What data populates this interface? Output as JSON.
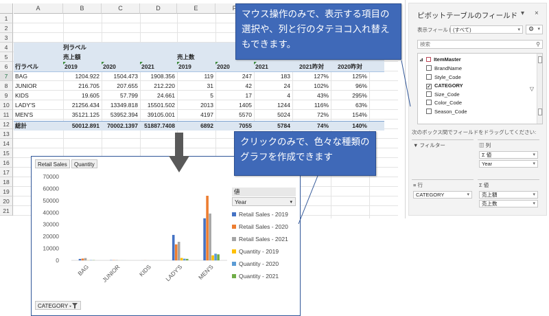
{
  "sheet": {
    "columns": [
      "A",
      "B",
      "C",
      "D",
      "E",
      "F"
    ],
    "rows": [
      "1",
      "2",
      "3",
      "4",
      "5",
      "6",
      "7",
      "8",
      "9",
      "10",
      "11",
      "12",
      "13",
      "14",
      "15",
      "16",
      "17",
      "18",
      "19",
      "20",
      "21"
    ],
    "selected_row": "7",
    "col_label_header": "列ラベル",
    "sales_header": "売上額",
    "qty_header": "売上数",
    "row_label_header": "行ラベル",
    "year_headers": [
      "2019",
      "2020",
      "2021",
      "2019",
      "2020",
      "2021"
    ],
    "extra_headers": [
      "2021昨対",
      "2020昨対"
    ],
    "data_rows": [
      {
        "label": "BAG",
        "values": [
          "1204.922",
          "1504.473",
          "1908.356",
          "119",
          "247",
          "183",
          "127%",
          "125%"
        ]
      },
      {
        "label": "JUNIOR",
        "values": [
          "216.705",
          "207.655",
          "212.220",
          "31",
          "42",
          "24",
          "102%",
          "96%"
        ]
      },
      {
        "label": "KIDS",
        "values": [
          "19.605",
          "57.799",
          "24.661",
          "5",
          "17",
          "4",
          "43%",
          "295%"
        ]
      },
      {
        "label": "LADY'S",
        "values": [
          "21256.434",
          "13349.818",
          "15501.502",
          "2013",
          "1405",
          "1244",
          "116%",
          "63%"
        ]
      },
      {
        "label": "MEN'S",
        "values": [
          "35121.125",
          "53952.394",
          "39105.001",
          "4197",
          "5570",
          "5024",
          "72%",
          "154%"
        ]
      }
    ],
    "total_row": {
      "label": "総計",
      "values": [
        "50012.891",
        "70002.1397",
        "51887.7408",
        "6892",
        "7055",
        "5784",
        "74%",
        "140%"
      ]
    }
  },
  "callouts": {
    "top": "マウス操作のみで、表示する項目の選択や、列と行のタテヨコ入れ替えもできます。",
    "chart": "クリックのみで、色々な種類のグラフを作成できます"
  },
  "chart": {
    "field_buttons": [
      "Retail Sales",
      "Quantity"
    ],
    "category_button": "CATEGORY",
    "legend_header": "値",
    "legend_field": "Year",
    "colors": [
      "#4472c4",
      "#ed7d31",
      "#a5a5a5",
      "#ffc000",
      "#5b9bd5",
      "#70ad47"
    ]
  },
  "chart_data": {
    "type": "bar",
    "categories": [
      "BAG",
      "JUNIOR",
      "KIDS",
      "LADY'S",
      "MEN'S"
    ],
    "ylim": [
      0,
      70000
    ],
    "yticks": [
      "70000",
      "60000",
      "50000",
      "40000",
      "30000",
      "20000",
      "10000",
      "0"
    ],
    "series": [
      {
        "name": "Retail Sales - 2019",
        "values": [
          1204.922,
          216.705,
          19.605,
          21256.434,
          35121.125
        ]
      },
      {
        "name": "Retail Sales - 2020",
        "values": [
          1504.473,
          207.655,
          57.799,
          13349.818,
          53952.394
        ]
      },
      {
        "name": "Retail Sales - 2021",
        "values": [
          1908.356,
          212.22,
          24.661,
          15501.502,
          39105.001
        ]
      },
      {
        "name": "Quantity - 2019",
        "values": [
          119,
          31,
          5,
          2013,
          4197
        ]
      },
      {
        "name": "Quantity - 2020",
        "values": [
          247,
          42,
          17,
          1405,
          5570
        ]
      },
      {
        "name": "Quantity - 2021",
        "values": [
          183,
          24,
          4,
          1244,
          5024
        ]
      }
    ]
  },
  "pane": {
    "title": "ピボットテーブルのフィールド",
    "close": "×",
    "report_filter_label": "表示フィールド:",
    "report_filter_value": "(すべて)",
    "search_placeholder": "検索",
    "table_name": "ItemMaster",
    "fields": [
      {
        "name": "BrandName",
        "checked": false
      },
      {
        "name": "Style_Code",
        "checked": false
      },
      {
        "name": "CATEGORY",
        "checked": true
      },
      {
        "name": "Size_Code",
        "checked": false
      },
      {
        "name": "Color_Code",
        "checked": false
      },
      {
        "name": "Season_Code",
        "checked": false
      }
    ],
    "drag_hint": "次のボックス間でフィールドをドラッグしてください:",
    "filter_area": "フィルター",
    "columns_area": "列",
    "rows_area": "行",
    "values_area": "値",
    "columns_items": [
      "Σ 値",
      "Year"
    ],
    "rows_items": [
      "CATEGORY"
    ],
    "values_items": [
      "売上額",
      "売上数"
    ]
  }
}
